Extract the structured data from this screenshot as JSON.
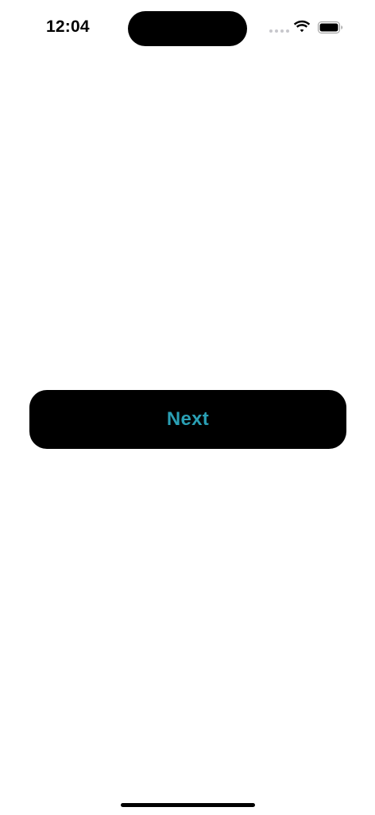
{
  "status_bar": {
    "time": "12:04",
    "icons": [
      "signal-dots-icon",
      "wifi-icon",
      "battery-icon"
    ]
  },
  "main": {
    "next_button": {
      "label": "Next",
      "background": "#000000",
      "text_color": "#2a9fb4"
    }
  },
  "colors": {
    "page_background": "#ffffff",
    "accent": "#2a9fb4"
  }
}
